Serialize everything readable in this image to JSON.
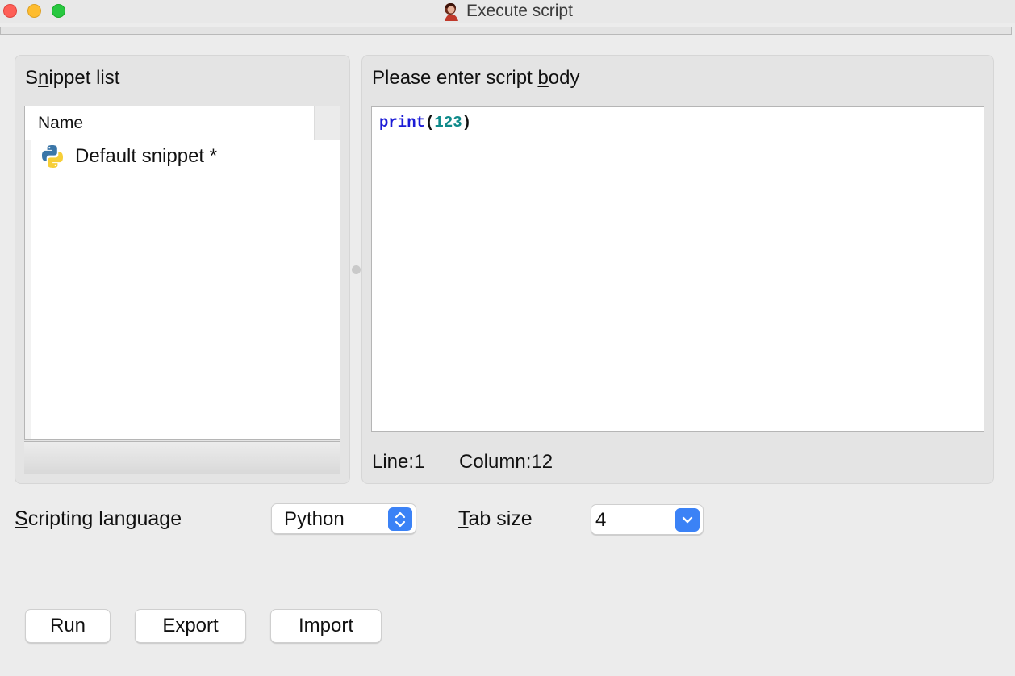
{
  "window": {
    "title": "Execute script"
  },
  "snippets": {
    "title_before": "S",
    "title_mnemonic": "n",
    "title_after": "ippet list",
    "column_header": "Name",
    "items": [
      {
        "label": "Default snippet *",
        "icon": "python-icon"
      }
    ]
  },
  "editor": {
    "title_before": "Please enter script ",
    "title_mnemonic": "b",
    "title_after": "ody",
    "code": {
      "keyword": "print",
      "open_paren": "(",
      "number": "123",
      "close_paren": ")"
    },
    "line_label": "Line:1",
    "column_label": "Column:12"
  },
  "settings": {
    "language_label_mnemonic": "S",
    "language_label_rest": "cripting language",
    "language_value": "Python",
    "tab_label_mnemonic": "T",
    "tab_label_rest": "ab size",
    "tab_value": "4"
  },
  "buttons": {
    "run": "Run",
    "export": "Export",
    "import": "Import"
  },
  "colors": {
    "accent": "#3b82f6",
    "keyword": "#1b1bd6",
    "number": "#0f8a8a"
  }
}
